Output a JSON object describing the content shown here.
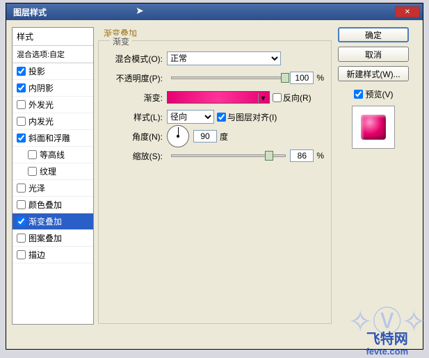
{
  "title": "图层样式",
  "styles": {
    "header": "样式",
    "subheader": "混合选项:自定",
    "items": [
      {
        "label": "投影",
        "checked": true,
        "indent": false
      },
      {
        "label": "内阴影",
        "checked": true,
        "indent": false
      },
      {
        "label": "外发光",
        "checked": false,
        "indent": false
      },
      {
        "label": "内发光",
        "checked": false,
        "indent": false
      },
      {
        "label": "斜面和浮雕",
        "checked": true,
        "indent": false
      },
      {
        "label": "等高线",
        "checked": false,
        "indent": true
      },
      {
        "label": "纹理",
        "checked": false,
        "indent": true
      },
      {
        "label": "光泽",
        "checked": false,
        "indent": false
      },
      {
        "label": "颜色叠加",
        "checked": false,
        "indent": false
      },
      {
        "label": "渐变叠加",
        "checked": true,
        "indent": false,
        "selected": true
      },
      {
        "label": "图案叠加",
        "checked": false,
        "indent": false
      },
      {
        "label": "描边",
        "checked": false,
        "indent": false
      }
    ]
  },
  "panel": {
    "group_title": "渐变叠加",
    "legend": "渐变",
    "blend_label": "混合模式(O):",
    "blend_value": "正常",
    "opacity_label": "不透明度(P):",
    "opacity_value": "100",
    "pct": "%",
    "gradient_label": "渐变:",
    "reverse_label": "反向(R)",
    "style_label": "样式(L):",
    "style_value": "径向",
    "align_label": "与图层对齐(I)",
    "angle_label": "角度(N):",
    "angle_value": "90",
    "angle_unit": "度",
    "scale_label": "缩放(S):",
    "scale_value": "86"
  },
  "buttons": {
    "ok": "确定",
    "cancel": "取消",
    "new_style": "新建样式(W)...",
    "preview": "预览(V)"
  },
  "watermark": {
    "brand": "飞特网",
    "url": "fevte.com"
  }
}
